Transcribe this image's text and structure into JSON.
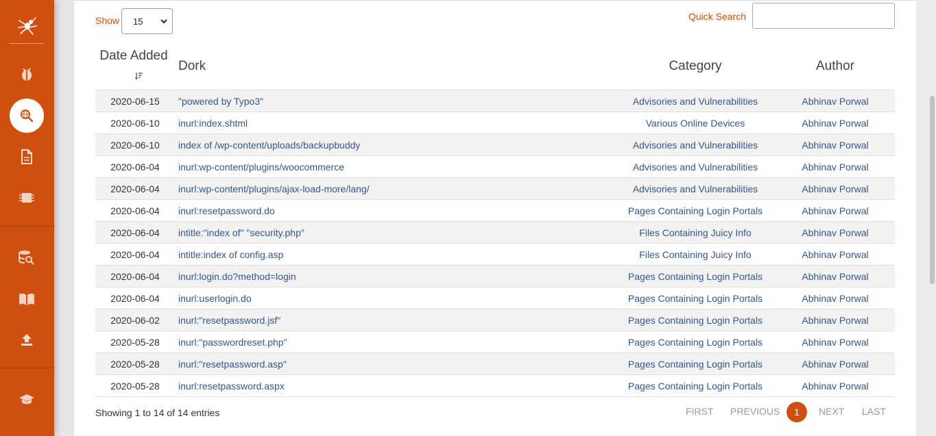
{
  "controls": {
    "show_label": "Show",
    "show_value": "15",
    "quick_search_label": "Quick Search",
    "quick_search_value": ""
  },
  "table": {
    "headers": {
      "date": "Date Added",
      "dork": "Dork",
      "category": "Category",
      "author": "Author"
    },
    "rows": [
      {
        "date": "2020-06-15",
        "dork": "\"powered by Typo3\"",
        "category": "Advisories and Vulnerabilities",
        "author": "Abhinav Porwal"
      },
      {
        "date": "2020-06-10",
        "dork": "inurl:index.shtml",
        "category": "Various Online Devices",
        "author": "Abhinav Porwal"
      },
      {
        "date": "2020-06-10",
        "dork": "index of /wp-content/uploads/backupbuddy",
        "category": "Advisories and Vulnerabilities",
        "author": "Abhinav Porwal"
      },
      {
        "date": "2020-06-04",
        "dork": "inurl:wp-content/plugins/woocommerce",
        "category": "Advisories and Vulnerabilities",
        "author": "Abhinav Porwal"
      },
      {
        "date": "2020-06-04",
        "dork": "inurl:wp-content/plugins/ajax-load-more/lang/",
        "category": "Advisories and Vulnerabilities",
        "author": "Abhinav Porwal"
      },
      {
        "date": "2020-06-04",
        "dork": "inurl:resetpassword.do",
        "category": "Pages Containing Login Portals",
        "author": "Abhinav Porwal"
      },
      {
        "date": "2020-06-04",
        "dork": "intitle:\"index of\" \"security.php\"",
        "category": "Files Containing Juicy Info",
        "author": "Abhinav Porwal"
      },
      {
        "date": "2020-06-04",
        "dork": "intitle:index of config.asp",
        "category": "Files Containing Juicy Info",
        "author": "Abhinav Porwal"
      },
      {
        "date": "2020-06-04",
        "dork": "inurl:login.do?method=login",
        "category": "Pages Containing Login Portals",
        "author": "Abhinav Porwal"
      },
      {
        "date": "2020-06-04",
        "dork": "inurl:userlogin.do",
        "category": "Pages Containing Login Portals",
        "author": "Abhinav Porwal"
      },
      {
        "date": "2020-06-02",
        "dork": "inurl:\"resetpassword.jsf\"",
        "category": "Pages Containing Login Portals",
        "author": "Abhinav Porwal"
      },
      {
        "date": "2020-05-28",
        "dork": "inurl:\"passwordreset.php\"",
        "category": "Pages Containing Login Portals",
        "author": "Abhinav Porwal"
      },
      {
        "date": "2020-05-28",
        "dork": "inurl:\"resetpassword.asp\"",
        "category": "Pages Containing Login Portals",
        "author": "Abhinav Porwal"
      },
      {
        "date": "2020-05-28",
        "dork": "inurl:resetpassword.aspx",
        "category": "Pages Containing Login Portals",
        "author": "Abhinav Porwal"
      }
    ]
  },
  "footer": {
    "info": "Showing 1 to 14 of 14 entries",
    "first": "FIRST",
    "previous": "PREVIOUS",
    "current": "1",
    "next": "NEXT",
    "last": "LAST"
  },
  "colors": {
    "accent": "#cf4f0f",
    "link": "#34558b"
  },
  "sidebar_icons": [
    "spider-logo-icon",
    "bug-icon",
    "search-globe-icon",
    "file-icon",
    "chip-icon",
    "database-search-icon",
    "book-icon",
    "upload-icon",
    "graduation-cap-icon"
  ]
}
